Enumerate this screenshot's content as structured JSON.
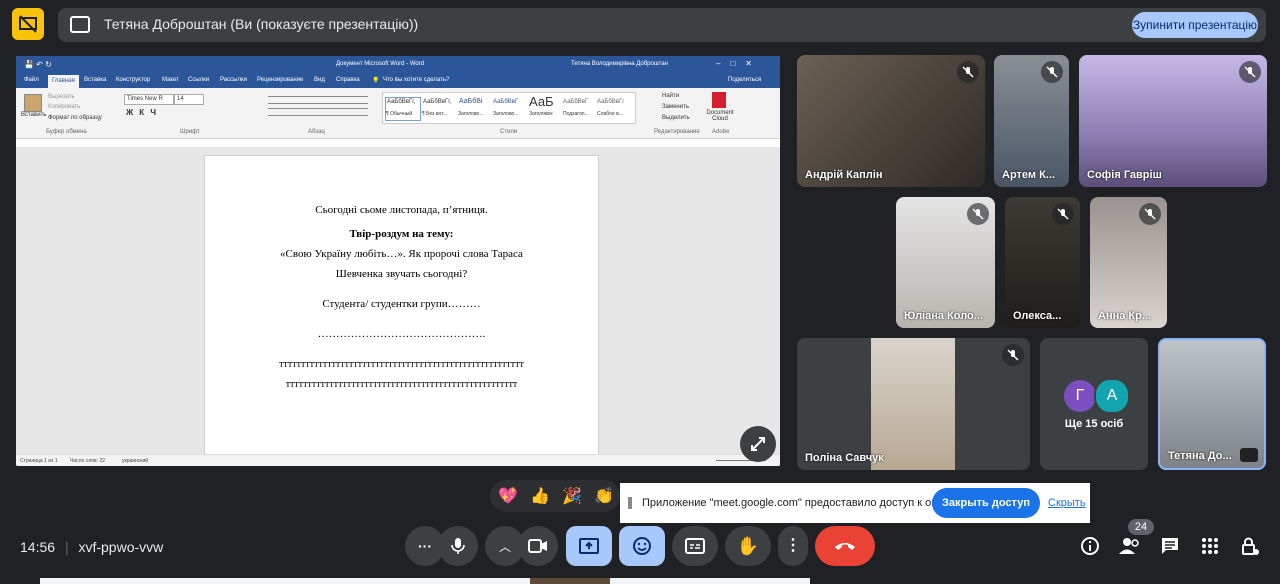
{
  "banner": {
    "title": "Тетяна Доброштан (Ви (показуєте презентацію))",
    "stop_label": "Зупинити презентацію"
  },
  "word": {
    "window_title": "Документ Microsoft Word  -  Word",
    "user_name": "Тетяна Володимирівна Доброштан",
    "menu": [
      "Файл",
      "Главная",
      "Вставка",
      "Конструктор",
      "Макет",
      "Ссылки",
      "Рассылки",
      "Рецензирование",
      "Вид",
      "Справка"
    ],
    "search_hint": "Что вы хотите сделать?",
    "share_label": "Поделиться",
    "ribbon": {
      "paste": "Вставить",
      "cut": "Вырезать",
      "copy": "Копировать",
      "format_painter": "Формат по образцу",
      "clipboard_group": "Буфер обмена",
      "font_name": "Times New R",
      "font_size": "14",
      "font_group": "Шрифт",
      "paragraph_group": "Абзац",
      "styles_group": "Стили",
      "styles": [
        "АаБбВвГг,",
        "АаБбВвГг,",
        "АаБбВі",
        "АаБбВвГ",
        "АаБ",
        "АаБбВвГ",
        "АаБбВвГг"
      ],
      "style_names": [
        "¶ Обычный",
        "¶ Без инт...",
        "Заголово...",
        "Заголово...",
        "Заголовок",
        "Подзагол...",
        "Слабое в..."
      ],
      "find": "Найти",
      "replace": "Заменить",
      "select": "Выделить",
      "editing_group": "Редактирование",
      "doc_cloud": "Document Cloud",
      "adobe": "Adobe"
    },
    "doc": {
      "line1": "Сьогодні сьоме листопада, п’ятниця.",
      "line2": "Твір-роздум на тему:",
      "line3": "«Свою Україну любіть…». Як пророчі слова Тараса",
      "line4": "Шевченка звучать сьогодні?",
      "line5": "Студента/ студентки групи………",
      "line6": "……………………………………….",
      "line7": "тттттттттттттттттттттттттттттттттттттттттттттттттттттттт",
      "line8": "ттттттттттттттттттттттттттттттттттттттттттттттттттттт"
    },
    "status": {
      "page": "Страница 1 из 1",
      "words": "Число слов: 22",
      "lang": "украинский"
    }
  },
  "participants": [
    {
      "name": "Андрій Каплін",
      "muted": true
    },
    {
      "name": "Артем К...",
      "muted": true
    },
    {
      "name": "Софія Гавріш",
      "muted": true
    },
    {
      "name": "Юліана Коло...",
      "muted": true
    },
    {
      "name": "Олекса...",
      "muted": true
    },
    {
      "name": "Анна Кр...",
      "muted": true
    },
    {
      "name": "Поліна Савчук",
      "muted": true
    },
    {
      "name": "Тетяна До...",
      "muted": false
    }
  ],
  "others": {
    "avatars": [
      "Г",
      "А"
    ],
    "avatar_colors": [
      "#7b4fbf",
      "#12a4af"
    ],
    "label": "Ще 15 осіб"
  },
  "reactions": [
    "💖",
    "👍",
    "🎉",
    "👏"
  ],
  "share_notice": {
    "text": "Приложение \"meet.google.com\" предоставило доступ к окну.",
    "close_label": "Закрыть доступ",
    "hide_label": "Скрыть"
  },
  "meeting": {
    "time": "14:56",
    "code": "xvf-ppwo-vvw",
    "participant_count": "24"
  },
  "colors": {
    "present_active": "#a8c7fa",
    "end_call": "#ea4335",
    "banner_icon": "#f9c20b"
  }
}
